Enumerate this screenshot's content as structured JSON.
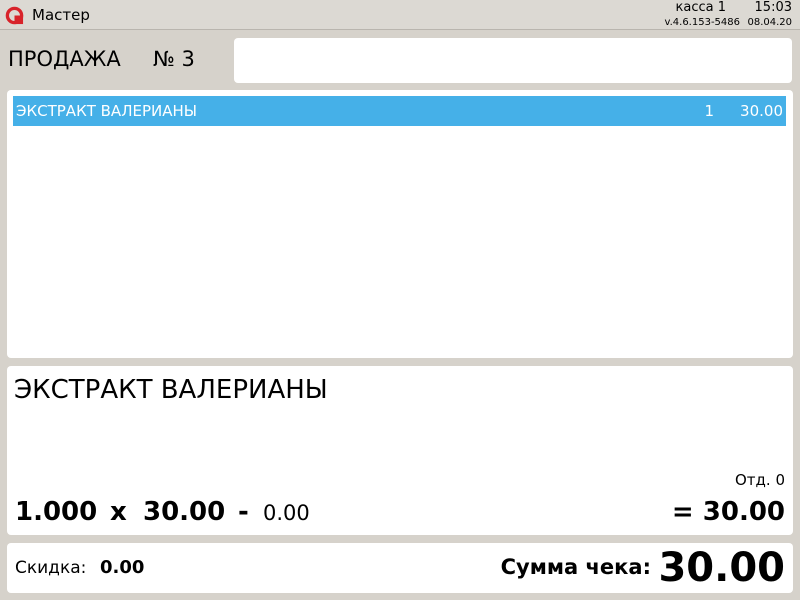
{
  "app": {
    "title": "Мастер",
    "register": "касса 1",
    "time": "15:03",
    "version": "v.4.6.153-5486",
    "date": "08.04.20",
    "logo_color": "#d8232a"
  },
  "sale": {
    "title": "ПРОДАЖА",
    "number": "№ 3",
    "input_value": ""
  },
  "items": [
    {
      "name": "ЭКСТРАКТ ВАЛЕРИАНЫ",
      "qty": "1",
      "price": "30.00",
      "selected": true
    }
  ],
  "details": {
    "name": "ЭКСТРАКТ ВАЛЕРИАНЫ",
    "department": "Отд. 0",
    "quantity": "1.000",
    "multiply": "x",
    "price": "30.00",
    "minus": "-",
    "discount": "0.00",
    "total": "= 30.00"
  },
  "footer": {
    "discount_label": "Скидка:",
    "discount_value": "0.00",
    "sum_label": "Сумма чека:",
    "sum_value": "30.00"
  },
  "colors": {
    "selection": "#45b0e8",
    "background": "#d6d2cb",
    "panel": "#ffffff"
  }
}
